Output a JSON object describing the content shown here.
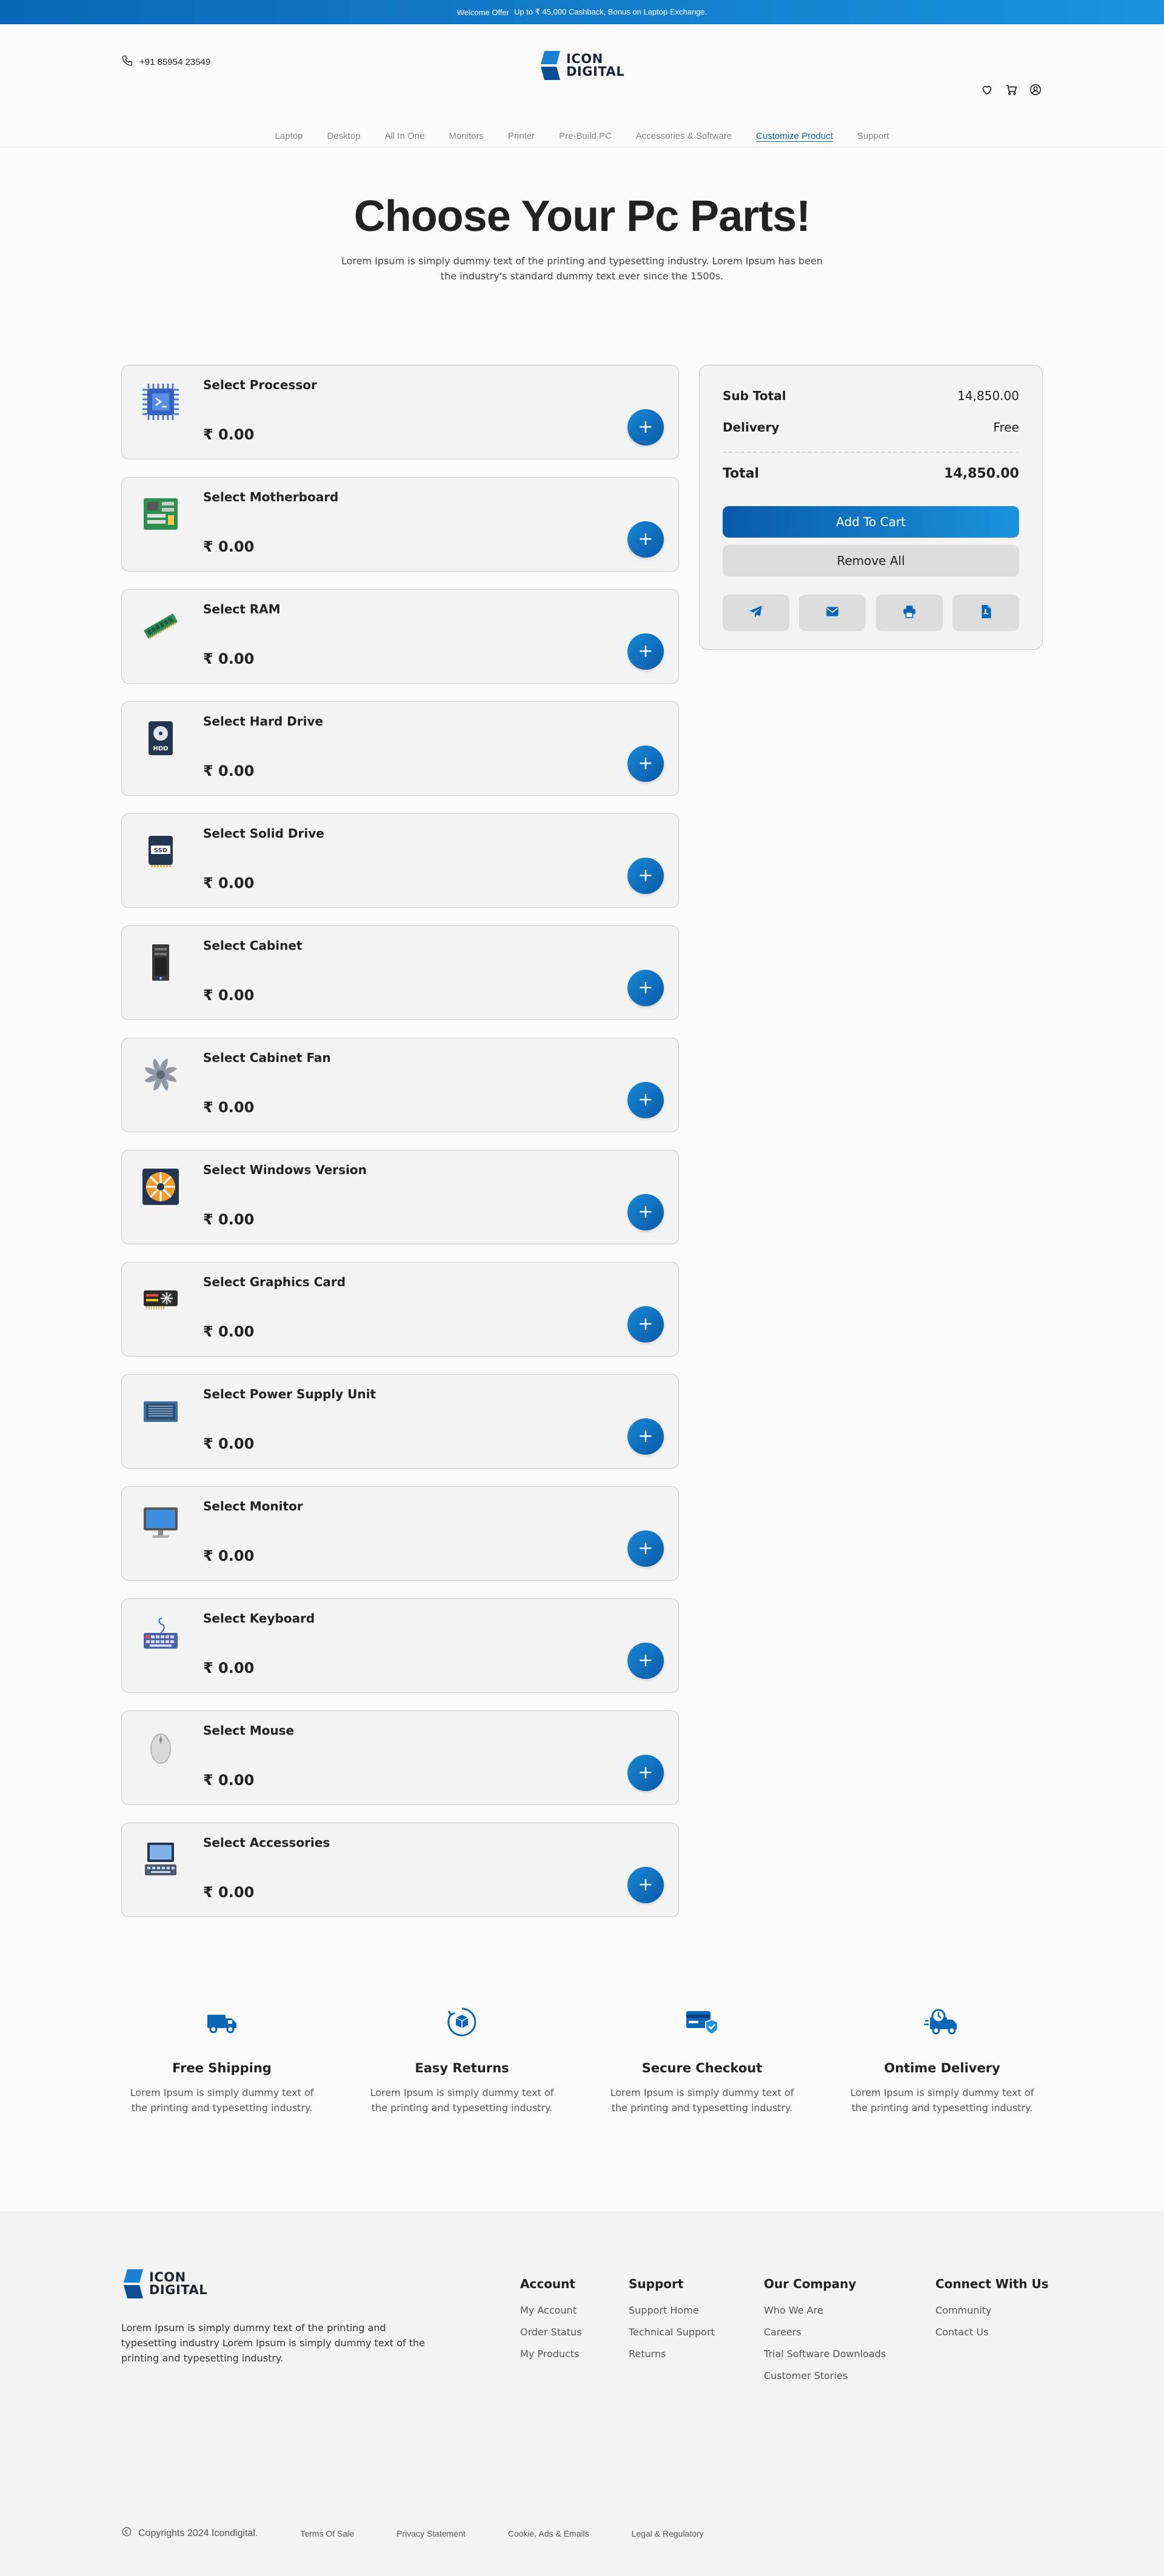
{
  "offer_bar": {
    "label": "Welcome Offer",
    "text": "Up to ₹ 45,000 Cashback, Bonus on Laptop Exchange."
  },
  "header": {
    "phone": "+91 85954 23549",
    "logo_line1": "ICON",
    "logo_line2": "DIGITAL",
    "icons": [
      "heart-icon",
      "cart-icon",
      "user-icon"
    ]
  },
  "nav": [
    {
      "label": "Laptop",
      "active": false
    },
    {
      "label": "Desktop",
      "active": false
    },
    {
      "label": "All In One",
      "active": false
    },
    {
      "label": "Monitors",
      "active": false
    },
    {
      "label": "Printer",
      "active": false
    },
    {
      "label": "Pre-Build PC",
      "active": false
    },
    {
      "label": "Accessories & Software",
      "active": false
    },
    {
      "label": "Customize Product",
      "active": true
    },
    {
      "label": "Support",
      "active": false
    }
  ],
  "hero": {
    "title": "Choose Your Pc Parts!",
    "subtitle": "Lorem Ipsum is simply dummy text of the printing and typesetting industry. Lorem Ipsum has been the industry's standard dummy text ever since the 1500s."
  },
  "parts": [
    {
      "name": "Select Processor",
      "price": "₹ 0.00",
      "icon": "processor-icon"
    },
    {
      "name": "Select Motherboard",
      "price": "₹ 0.00",
      "icon": "motherboard-icon"
    },
    {
      "name": "Select RAM",
      "price": "₹ 0.00",
      "icon": "ram-icon"
    },
    {
      "name": "Select Hard Drive",
      "price": "₹ 0.00",
      "icon": "hard-drive-icon",
      "icon_text": "HDD"
    },
    {
      "name": "Select Solid Drive",
      "price": "₹ 0.00",
      "icon": "ssd-icon",
      "icon_text": "SSD"
    },
    {
      "name": "Select Cabinet",
      "price": "₹ 0.00",
      "icon": "cabinet-icon"
    },
    {
      "name": "Select Cabinet Fan",
      "price": "₹ 0.00",
      "icon": "fan-icon"
    },
    {
      "name": "Select Windows Version",
      "price": "₹ 0.00",
      "icon": "windows-icon"
    },
    {
      "name": "Select Graphics Card",
      "price": "₹ 0.00",
      "icon": "graphics-card-icon"
    },
    {
      "name": "Select Power Supply Unit",
      "price": "₹ 0.00",
      "icon": "psu-icon"
    },
    {
      "name": "Select Monitor",
      "price": "₹ 0.00",
      "icon": "monitor-icon"
    },
    {
      "name": "Select Keyboard",
      "price": "₹ 0.00",
      "icon": "keyboard-icon"
    },
    {
      "name": "Select Mouse",
      "price": "₹ 0.00",
      "icon": "mouse-icon"
    },
    {
      "name": "Select Accessories",
      "price": "₹ 0.00",
      "icon": "accessories-icon"
    }
  ],
  "add_symbol": "+",
  "summary": {
    "subtotal_label": "Sub Total",
    "subtotal_value": "14,850.00",
    "delivery_label": "Delivery",
    "delivery_value": "Free",
    "total_label": "Total",
    "total_value": "14,850.00",
    "add_to_cart": "Add To Cart",
    "remove_all": "Remove All",
    "share_icons": [
      "telegram-icon",
      "email-icon",
      "print-icon",
      "pdf-icon"
    ]
  },
  "features": [
    {
      "icon": "truck-icon",
      "title": "Free Shipping",
      "text": "Lorem Ipsum is simply dummy text of the printing and typesetting industry."
    },
    {
      "icon": "returns-icon",
      "title": "Easy Returns",
      "text": "Lorem Ipsum is simply dummy text of the printing and typesetting industry."
    },
    {
      "icon": "secure-card-icon",
      "title": "Secure Checkout",
      "text": "Lorem Ipsum is simply dummy text of the printing and typesetting industry."
    },
    {
      "icon": "delivery-clock-icon",
      "title": "Ontime Delivery",
      "text": "Lorem Ipsum is simply dummy text of the printing and typesetting industry."
    }
  ],
  "footer": {
    "logo_line1": "ICON",
    "logo_line2": "DIGITAL",
    "description": "Lorem Ipsum is simply dummy text of the printing and typesetting industry Lorem Ipsum is simply dummy text of the printing and typesetting industry.",
    "columns": [
      {
        "title": "Account",
        "links": [
          "My Account",
          "Order Status",
          "My Products"
        ]
      },
      {
        "title": "Support",
        "links": [
          "Support Home",
          "Technical Support",
          "Returns"
        ]
      },
      {
        "title": "Our Company",
        "links": [
          "Who We Are",
          "Careers",
          "Trial Software Downloads",
          "Customer Stories"
        ]
      },
      {
        "title": "Connect With Us",
        "links": [
          "Community",
          "Contact Us"
        ]
      }
    ],
    "copyright": "Copyrights 2024 Icondigital.",
    "legal_links": [
      "Terms Of Sale",
      "Privacy Statement",
      "Cookie, Ads & Emails",
      "Legal & Regulatory"
    ]
  },
  "colors": {
    "brand_blue": "#0a66b8",
    "brand_blue_light": "#1a93de"
  }
}
